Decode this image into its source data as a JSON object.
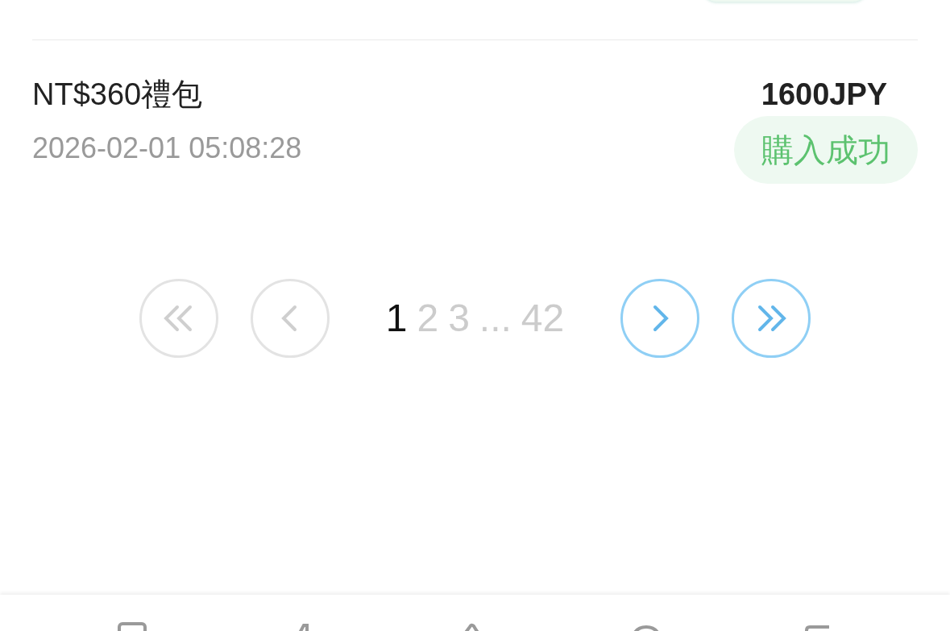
{
  "orders": [
    {
      "title": "NT$360禮包",
      "time": "2026-02-01 05:08:28",
      "price": "1600JPY",
      "status": "購入成功"
    }
  ],
  "pagination": {
    "first": {
      "disabled": true
    },
    "prev": {
      "disabled": true
    },
    "pages": [
      {
        "label": "1",
        "selected": true
      },
      {
        "label": "2",
        "selected": false
      },
      {
        "label": "3",
        "selected": false
      },
      {
        "label": "...",
        "selected": false
      },
      {
        "label": "42",
        "selected": false
      }
    ],
    "next": {
      "disabled": false
    },
    "last": {
      "disabled": false
    }
  }
}
